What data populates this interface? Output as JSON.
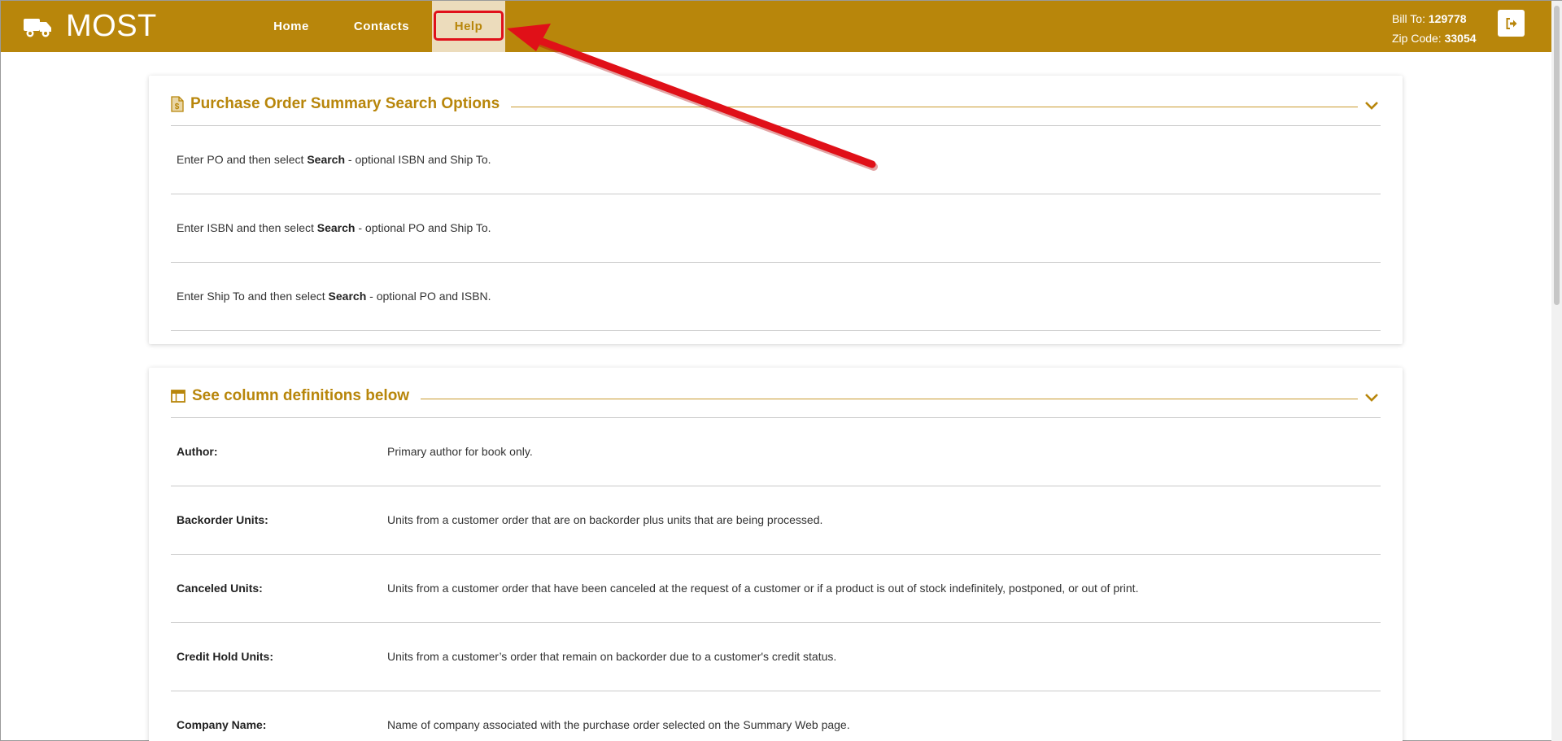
{
  "header": {
    "brand": "MOST",
    "nav": [
      {
        "label": "Home"
      },
      {
        "label": "Contacts"
      },
      {
        "label": "Help"
      }
    ],
    "bill_to_label": "Bill To:",
    "bill_to_value": "129778",
    "zip_label": "Zip Code:",
    "zip_value": "33054",
    "brand_icon": "truck-icon",
    "logout_icon": "sign-out-icon"
  },
  "search_options": {
    "title": "Purchase Order Summary Search Options",
    "icon": "document-dollar-icon",
    "rows": [
      {
        "before": "Enter PO and then select ",
        "bold": "Search",
        "after": " - optional ISBN and Ship To."
      },
      {
        "before": "Enter ISBN and then select ",
        "bold": "Search",
        "after": " - optional PO and Ship To."
      },
      {
        "before": "Enter Ship To and then select ",
        "bold": "Search",
        "after": " - optional PO and ISBN."
      }
    ]
  },
  "definitions": {
    "title": "See column definitions below",
    "icon": "table-icon",
    "rows": [
      {
        "term": "Author:",
        "desc": "Primary author for book only."
      },
      {
        "term": "Backorder Units:",
        "desc": "Units from a customer order that are on backorder plus units that are being processed."
      },
      {
        "term": "Canceled Units:",
        "desc": "Units from a customer order that have been canceled at the request of a customer or if a product is out of stock indefinitely, postponed, or out of print."
      },
      {
        "term": "Credit Hold Units:",
        "desc": "Units from a customer’s order that remain on backorder due to a customer's credit status."
      },
      {
        "term": "Company Name:",
        "desc": "Name of company associated with the purchase order selected on the Summary Web page."
      }
    ]
  },
  "colors": {
    "brand": "#b8860b",
    "nav_active_bg": "#ecdcbc",
    "highlight": "#e0101a"
  }
}
